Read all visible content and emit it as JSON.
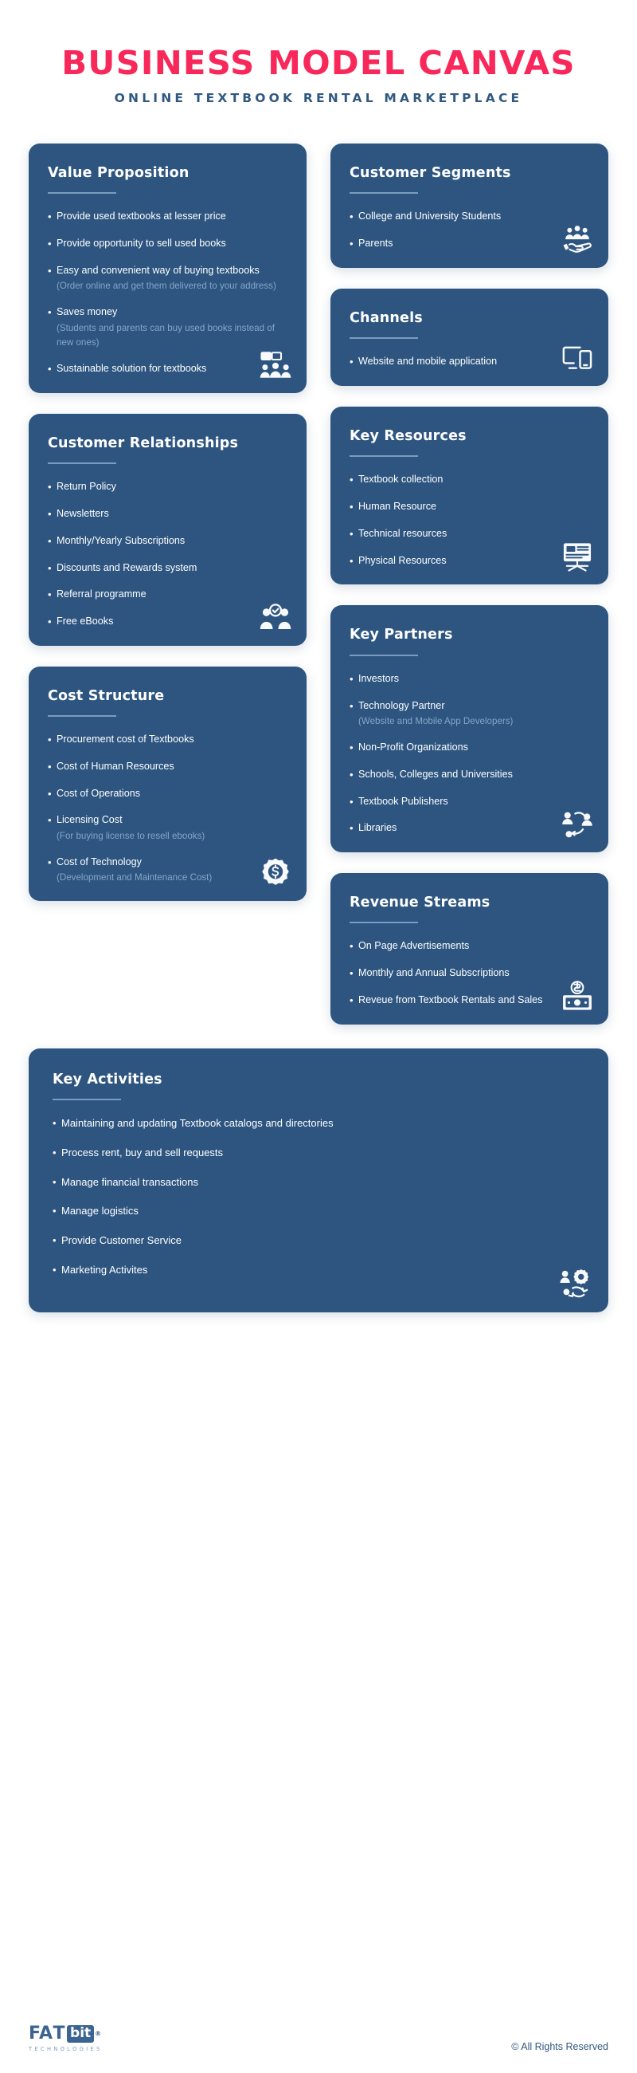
{
  "header": {
    "title": "BUSINESS MODEL CANVAS",
    "subtitle": "ONLINE TEXTBOOK RENTAL MARKETPLACE"
  },
  "colors": {
    "title_pink": "#f8285a",
    "card_blue": "#2d5580",
    "subtitle_blue": "#31587f",
    "subtext_blue": "#85a6c7",
    "rule_blue": "#7a9cc0",
    "page_background": "#ffffff"
  },
  "left_column": [
    {
      "id": "value-proposition",
      "heading": "Value Proposition",
      "icon": "people-group-icon",
      "items": [
        {
          "main": "Provide used textbooks at lesser price",
          "sub": ""
        },
        {
          "main": "Provide opportunity to sell used books",
          "sub": ""
        },
        {
          "main": "Easy and convenient way of buying textbooks",
          "sub": "(Order online and get them delivered to your address)"
        },
        {
          "main": "Saves money",
          "sub": "(Students and parents can buy used books instead of new ones)"
        },
        {
          "main": "Sustainable solution for textbooks",
          "sub": ""
        }
      ]
    },
    {
      "id": "customer-relationships",
      "heading": "Customer Relationships",
      "icon": "user-check-icon",
      "items": [
        {
          "main": "Return Policy",
          "sub": ""
        },
        {
          "main": "Newsletters",
          "sub": ""
        },
        {
          "main": "Monthly/Yearly Subscriptions",
          "sub": ""
        },
        {
          "main": "Discounts and Rewards system",
          "sub": ""
        },
        {
          "main": "Referral programme",
          "sub": ""
        },
        {
          "main": "Free eBooks",
          "sub": ""
        }
      ]
    },
    {
      "id": "cost-structure",
      "heading": "Cost Structure",
      "icon": "money-gear-icon",
      "items": [
        {
          "main": "Procurement cost of Textbooks",
          "sub": ""
        },
        {
          "main": "Cost of Human Resources",
          "sub": ""
        },
        {
          "main": "Cost of Operations",
          "sub": ""
        },
        {
          "main": "Licensing Cost",
          "sub": "(For buying license to resell ebooks)"
        },
        {
          "main": "Cost of Technology",
          "sub": "(Development and Maintenance Cost)"
        }
      ]
    }
  ],
  "right_column": [
    {
      "id": "customer-segments",
      "heading": "Customer Segments",
      "icon": "people-in-hand-icon",
      "items": [
        {
          "main": "College and University Students",
          "sub": ""
        },
        {
          "main": "Parents",
          "sub": ""
        }
      ]
    },
    {
      "id": "channels",
      "heading": "Channels",
      "icon": "devices-icon",
      "items": [
        {
          "main": "Website and mobile application",
          "sub": ""
        }
      ]
    },
    {
      "id": "key-resources",
      "heading": "Key Resources",
      "icon": "presentation-board-icon",
      "items": [
        {
          "main": "Textbook collection",
          "sub": ""
        },
        {
          "main": "Human Resource",
          "sub": ""
        },
        {
          "main": "Technical resources",
          "sub": ""
        },
        {
          "main": "Physical Resources",
          "sub": ""
        }
      ]
    },
    {
      "id": "key-partners",
      "heading": "Key Partners",
      "icon": "partnership-network-icon",
      "items": [
        {
          "main": "Investors",
          "sub": ""
        },
        {
          "main": "Technology Partner",
          "sub": "(Website and Mobile App Developers)"
        },
        {
          "main": "Non-Profit Organizations",
          "sub": ""
        },
        {
          "main": "Schools, Colleges and Universities",
          "sub": ""
        },
        {
          "main": "Textbook Publishers",
          "sub": ""
        },
        {
          "main": "Libraries",
          "sub": ""
        }
      ]
    },
    {
      "id": "revenue-streams",
      "heading": "Revenue Streams",
      "icon": "cash-money-icon",
      "items": [
        {
          "main": "On Page Advertisements",
          "sub": ""
        },
        {
          "main": "Monthly and Annual Subscriptions",
          "sub": ""
        },
        {
          "main": "Reveue from Textbook Rentals and Sales",
          "sub": ""
        }
      ]
    }
  ],
  "bottom_card": {
    "id": "key-activities",
    "heading": "Key Activities",
    "icon": "process-gear-icon",
    "items": [
      {
        "main": "Maintaining and updating Textbook catalogs and directories",
        "sub": ""
      },
      {
        "main": "Process rent, buy and sell requests",
        "sub": ""
      },
      {
        "main": "Manage financial transactions",
        "sub": ""
      },
      {
        "main": "Manage logistics",
        "sub": ""
      },
      {
        "main": "Provide Customer Service",
        "sub": ""
      },
      {
        "main": "Marketing Activites",
        "sub": ""
      }
    ]
  },
  "footer": {
    "logo_main": "FA",
    "logo_t": "T",
    "logo_badge": "bit",
    "logo_registered": "®",
    "logo_sub": "TECHNOLOGIES",
    "copyright": "© All Rights Reserved"
  },
  "bullet_glyph": "•"
}
